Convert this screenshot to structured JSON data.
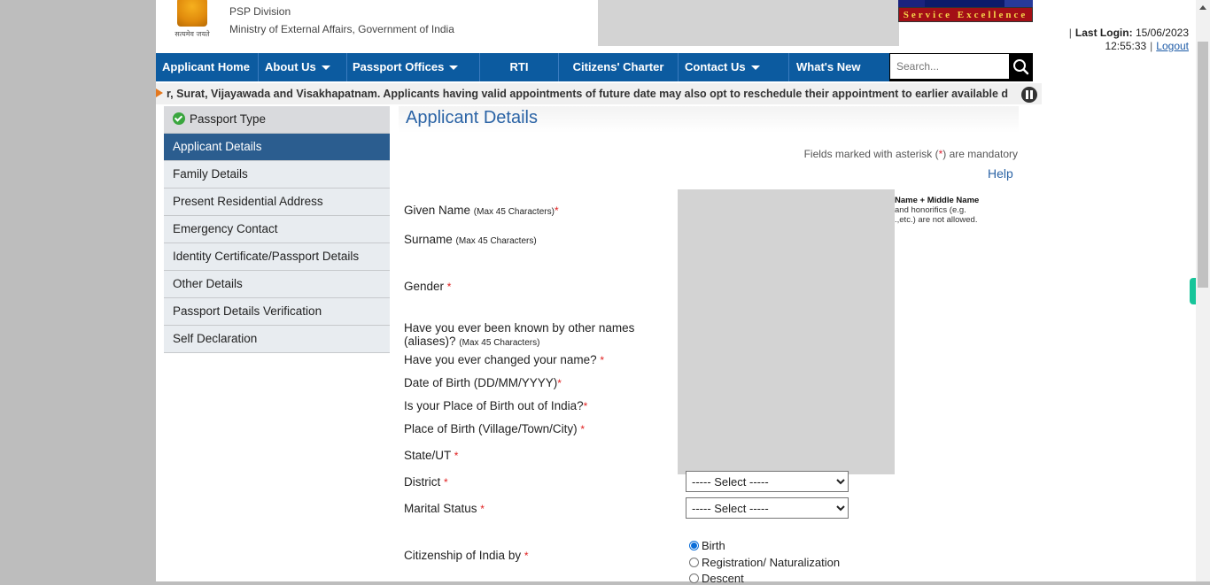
{
  "header": {
    "emblem_motto": "सत्यमेव जयते",
    "division": "PSP Division",
    "ministry": "Ministry of External Affairs, Government of India",
    "service_logo_text": "Service Excellence",
    "last_login_label": "Last Login:",
    "last_login_date": "15/06/2023",
    "last_login_time": "12:55:33",
    "separator": "|",
    "logout": "Logout"
  },
  "nav": {
    "items": [
      {
        "label": "Applicant Home",
        "dropdown": false
      },
      {
        "label": "About Us",
        "dropdown": true
      },
      {
        "label": "Passport Offices",
        "dropdown": true
      },
      {
        "label": "RTI",
        "dropdown": false
      },
      {
        "label": "Citizens' Charter",
        "dropdown": false
      },
      {
        "label": "Contact Us",
        "dropdown": true
      },
      {
        "label": "What's New",
        "dropdown": false
      }
    ],
    "search_placeholder": "Search...",
    "search_icon": "search-icon"
  },
  "ticker": {
    "text": "r, Surat, Vijayawada and Visakhapatnam. Applicants having valid appointments of future date may also opt to reschedule their appointment to earlier available date as |",
    "pause_icon": "pause-icon"
  },
  "sidebar": {
    "items": [
      {
        "label": "Passport Type",
        "state": "done"
      },
      {
        "label": "Applicant Details",
        "state": "active"
      },
      {
        "label": "Family Details",
        "state": ""
      },
      {
        "label": "Present Residential Address",
        "state": ""
      },
      {
        "label": "Emergency Contact",
        "state": ""
      },
      {
        "label": "Identity Certificate/Passport Details",
        "state": ""
      },
      {
        "label": "Other Details",
        "state": ""
      },
      {
        "label": "Passport Details Verification",
        "state": ""
      },
      {
        "label": "Self Declaration",
        "state": ""
      }
    ]
  },
  "main": {
    "title": "Applicant Details",
    "mandatory_note_pre": "Fields marked with asterisk (",
    "mandatory_note_ast": "*",
    "mandatory_note_post": ") are mandatory",
    "help": "Help",
    "hint_bold": "Name + Middle Name",
    "hint_line1": "and honorifics (e.g.",
    "hint_line2": ".,etc.) are not allowed.",
    "fields": {
      "given_name": {
        "label": "Given Name",
        "note": "(Max 45 Characters)",
        "req": "*"
      },
      "surname": {
        "label": "Surname",
        "note": "(Max 45 Characters)"
      },
      "gender": {
        "label": "Gender",
        "req": "*"
      },
      "aliases": {
        "label1": "Have you ever been known by other names",
        "label2": "(aliases)?",
        "note": "(Max 45 Characters)"
      },
      "changed_name": {
        "label": "Have you ever changed your name?",
        "req": "*"
      },
      "dob": {
        "label": "Date of Birth (DD/MM/YYYY)",
        "req": "*"
      },
      "pob_outside": {
        "label": "Is your Place of Birth out of India?",
        "req": "*"
      },
      "pob": {
        "label": "Place of Birth (Village/Town/City)",
        "req": "*"
      },
      "state": {
        "label": "State/UT",
        "req": "*"
      },
      "district": {
        "label": "District",
        "req": "*",
        "value": "----- Select -----"
      },
      "marital": {
        "label": "Marital Status",
        "req": "*",
        "value": "----- Select -----"
      },
      "citizenship": {
        "label": "Citizenship of India by",
        "req": "*",
        "options": [
          {
            "label": "Birth",
            "checked": true
          },
          {
            "label": "Registration/ Naturalization",
            "checked": false
          },
          {
            "label": "Descent",
            "checked": false
          }
        ]
      }
    }
  }
}
